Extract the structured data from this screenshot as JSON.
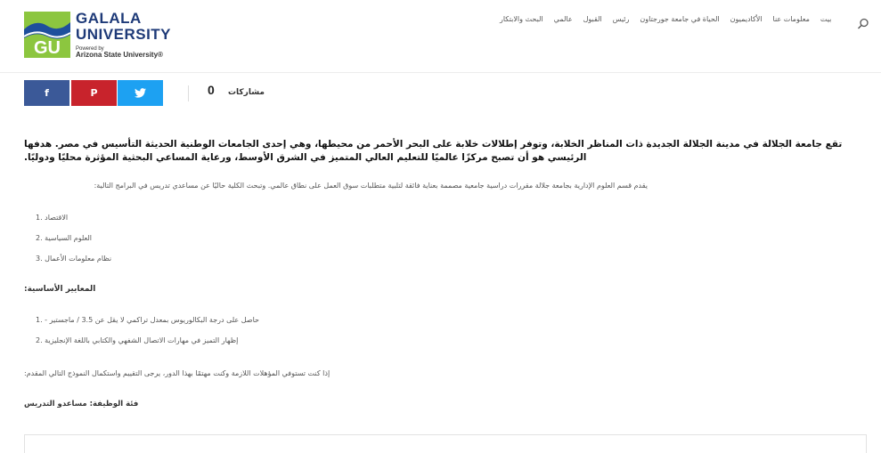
{
  "logo": {
    "initials": "GU",
    "name_line1": "GALALA",
    "name_line2": "UNIVERSITY",
    "powered_by": "Powered by",
    "partner": "Arizona State University®"
  },
  "nav": {
    "items": [
      "بيت",
      "معلومات عنا",
      "الأكاديميون",
      "الحياة في جامعة جورجتاون",
      "رئيس",
      "القبول",
      "عالمي",
      "البحث والابتكار"
    ]
  },
  "share": {
    "facebook": "f",
    "pinterest": "P",
    "twitter": "t",
    "count": "0",
    "label": "مشاركات"
  },
  "content": {
    "lead": "تقع جامعة الجلالة في مدينة الجلالة الجديدة ذات المناظر الخلابة، وتوفر إطلالات خلابة على البحر الأحمر من محيطها، وهي إحدى الجامعات الوطنية الحديثة التأسيس في مصر. هدفها الرئيسي هو أن تصبح مركزًا عالميًا للتعليم العالي المتميز في الشرق الأوسط، ورعاية المساعي البحثية المؤثرة محليًا ودوليًا.",
    "intro": "يقدم قسم العلوم الإدارية بجامعة جلالة مقررات دراسية جامعية مصممة بعناية فائقة لتلبية متطلبات سوق العمل على نطاق عالمي. وتبحث الكلية حاليًا عن مساعدي تدريس في البرامج التالية:",
    "programs": [
      "الاقتصاد .1",
      "العلوم السياسية .2",
      "نظام معلومات الأعمال .3"
    ],
    "criteria_heading": "المعايير الأساسية:",
    "criteria": [
      "حاصل على درجة البكالوريوس بمعدل تراكمي لا يقل عن 3.5 / ماجستير - .1",
      "إظهار التميز في مهارات الاتصال الشفهي والكتابي باللغة الإنجليزية .2"
    ],
    "apply": "إذا كنت تستوفي المؤهلات اللازمة وكنت مهتمًا بهذا الدور، يرجى التقييم واستكمال النموذج التالي المقدم:",
    "category": "فئة الوظيفة: مساعدو التدريس"
  }
}
